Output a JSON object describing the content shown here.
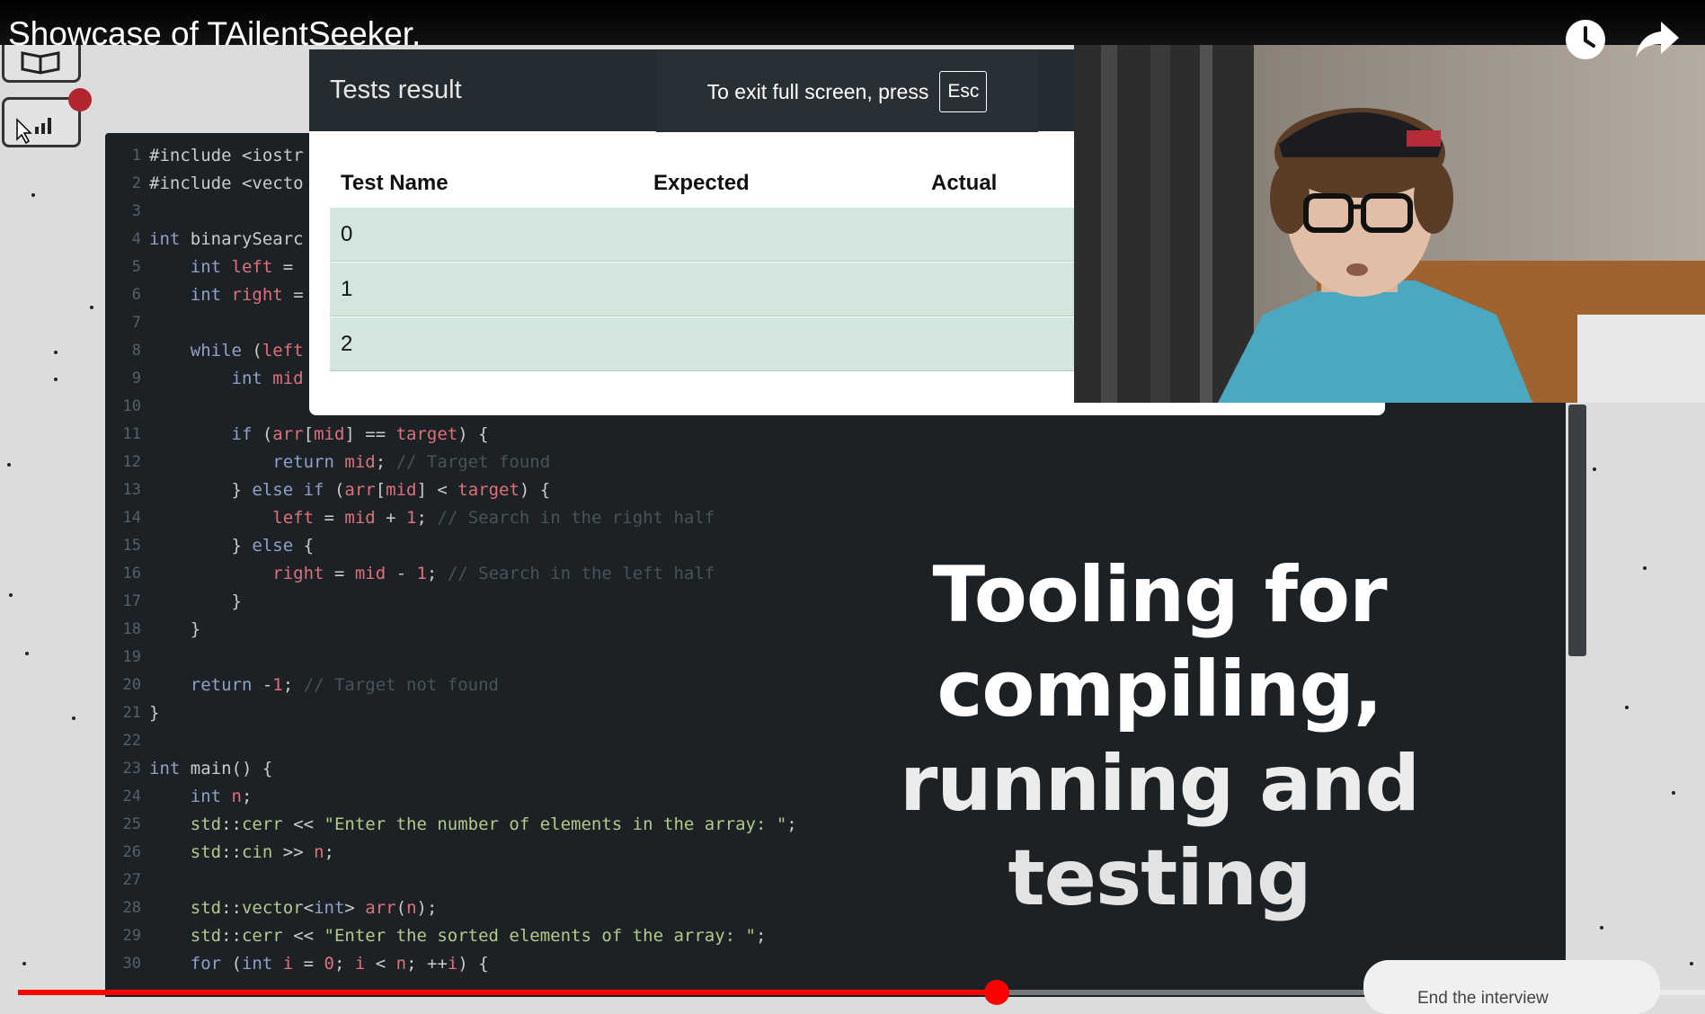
{
  "video": {
    "title": "Showcase of TAilentSeeker.",
    "watch_later_icon": "clock-icon",
    "share_icon": "share-icon",
    "progress": 0.58
  },
  "fullscreen_toast": {
    "text": "To exit full screen, press",
    "key": "Esc"
  },
  "tests_modal": {
    "title": "Tests result",
    "columns": [
      "Test Name",
      "Expected",
      "Actual"
    ],
    "rows": [
      {
        "name": "0",
        "expected": "",
        "actual": ""
      },
      {
        "name": "1",
        "expected": "",
        "actual": ""
      },
      {
        "name": "2",
        "expected": "",
        "actual": ""
      }
    ]
  },
  "overlay_caption": {
    "line1": "Tooling for",
    "line2": "compiling,",
    "line3": "running and",
    "line4": "testing"
  },
  "editor": {
    "lines": [
      {
        "n": "1",
        "code": "#include <iostr"
      },
      {
        "n": "2",
        "code": "#include <vecto"
      },
      {
        "n": "3",
        "code": ""
      },
      {
        "n": "4",
        "code": "int binarySearc"
      },
      {
        "n": "5",
        "code": "    int left = "
      },
      {
        "n": "6",
        "code": "    int right = "
      },
      {
        "n": "7",
        "code": ""
      },
      {
        "n": "8",
        "code": "    while (left"
      },
      {
        "n": "9",
        "code": "        int mid"
      },
      {
        "n": "10",
        "code": ""
      },
      {
        "n": "11",
        "code": "        if (arr[mid] == target) {"
      },
      {
        "n": "12",
        "code": "            return mid; // Target found"
      },
      {
        "n": "13",
        "code": "        } else if (arr[mid] < target) {"
      },
      {
        "n": "14",
        "code": "            left = mid + 1; // Search in the right half"
      },
      {
        "n": "15",
        "code": "        } else {"
      },
      {
        "n": "16",
        "code": "            right = mid - 1; // Search in the left half"
      },
      {
        "n": "17",
        "code": "        }"
      },
      {
        "n": "18",
        "code": "    }"
      },
      {
        "n": "19",
        "code": ""
      },
      {
        "n": "20",
        "code": "    return -1; // Target not found"
      },
      {
        "n": "21",
        "code": "}"
      },
      {
        "n": "22",
        "code": ""
      },
      {
        "n": "23",
        "code": "int main() {"
      },
      {
        "n": "24",
        "code": "    int n;"
      },
      {
        "n": "25",
        "code": "    std::cerr << \"Enter the number of elements in the array: \";"
      },
      {
        "n": "26",
        "code": "    std::cin >> n;"
      },
      {
        "n": "27",
        "code": ""
      },
      {
        "n": "28",
        "code": "    std::vector<int> arr(n);"
      },
      {
        "n": "29",
        "code": "    std::cerr << \"Enter the sorted elements of the array: \";"
      },
      {
        "n": "30",
        "code": "    for (int i = 0; i < n; ++i) {"
      }
    ]
  },
  "end_interview": {
    "label": "End the interview"
  },
  "colors": {
    "editor_bg": "#1b2124",
    "keyword": "#8fa1c8",
    "variable": "#e0717c",
    "comment": "#4a5358",
    "string": "#b5c98a",
    "row_pass": "#d3e6dd",
    "progress": "#ff0000"
  }
}
